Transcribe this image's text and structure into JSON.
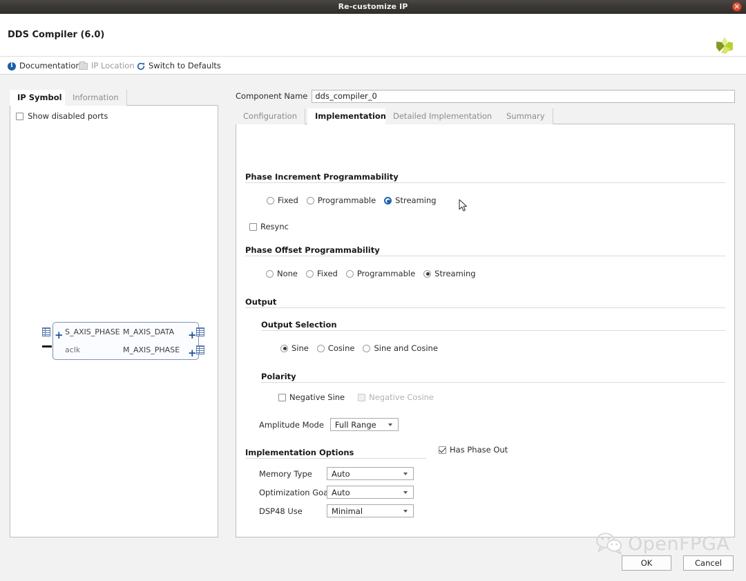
{
  "window": {
    "title": "Re-customize IP",
    "close_icon": "close-icon",
    "header_title": "DDS Compiler (6.0)",
    "logo_icon": "xilinx-logo-icon"
  },
  "toolbar": {
    "items": [
      {
        "label": "Documentation",
        "icon": "info-icon",
        "disabled": false
      },
      {
        "label": "IP Location",
        "icon": "folder-icon",
        "disabled": true
      },
      {
        "label": "Switch to Defaults",
        "icon": "refresh-icon",
        "disabled": false
      }
    ]
  },
  "left_panel": {
    "tabs": [
      {
        "label": "IP Symbol",
        "active": true
      },
      {
        "label": "Information",
        "active": false
      }
    ],
    "show_disabled_ports": {
      "label": "Show disabled ports",
      "checked": false
    },
    "ip_symbol": {
      "left_ports": [
        {
          "name": "S_AXIS_PHASE",
          "kind": "bus"
        },
        {
          "name": "aclk",
          "kind": "clock"
        }
      ],
      "right_ports": [
        {
          "name": "M_AXIS_DATA",
          "kind": "bus"
        },
        {
          "name": "M_AXIS_PHASE",
          "kind": "bus"
        }
      ]
    }
  },
  "main": {
    "component_name": {
      "label": "Component Name",
      "value": "dds_compiler_0"
    },
    "tabs": [
      {
        "label": "Configuration",
        "active": false
      },
      {
        "label": "Implementation",
        "active": true
      },
      {
        "label": "Detailed Implementation",
        "active": false
      },
      {
        "label": "Summary",
        "active": false
      }
    ],
    "phase_increment": {
      "title": "Phase Increment Programmability",
      "options": [
        {
          "label": "Fixed",
          "selected": false
        },
        {
          "label": "Programmable",
          "selected": false
        },
        {
          "label": "Streaming",
          "selected": true
        }
      ],
      "resync": {
        "label": "Resync",
        "checked": false
      }
    },
    "phase_offset": {
      "title": "Phase Offset Programmability",
      "options": [
        {
          "label": "None",
          "selected": false
        },
        {
          "label": "Fixed",
          "selected": false
        },
        {
          "label": "Programmable",
          "selected": false
        },
        {
          "label": "Streaming",
          "selected": true
        }
      ]
    },
    "output": {
      "title": "Output",
      "output_selection": {
        "title": "Output Selection",
        "options": [
          {
            "label": "Sine",
            "selected": true
          },
          {
            "label": "Cosine",
            "selected": false
          },
          {
            "label": "Sine and Cosine",
            "selected": false
          }
        ]
      },
      "polarity": {
        "title": "Polarity",
        "options": [
          {
            "label": "Negative Sine",
            "checked": false,
            "disabled": false
          },
          {
            "label": "Negative Cosine",
            "checked": false,
            "disabled": true
          }
        ]
      },
      "amplitude_mode": {
        "label": "Amplitude Mode",
        "value": "Full Range"
      }
    },
    "implementation_options": {
      "title": "Implementation Options",
      "fields": [
        {
          "label": "Memory Type",
          "value": "Auto"
        },
        {
          "label": "Optimization Goal",
          "value": "Auto"
        },
        {
          "label": "DSP48 Use",
          "value": "Minimal"
        }
      ]
    },
    "has_phase_out": {
      "label": "Has Phase Out",
      "checked": true
    }
  },
  "footer": {
    "ok_label": "OK",
    "cancel_label": "Cancel"
  },
  "watermark": {
    "text": "OpenFPGA",
    "icon": "wechat-bubble-icon"
  },
  "colors": {
    "accent_blue": "#1c5fb0",
    "titlebar": "#3b3835",
    "close_red": "#d1462a",
    "panel_border": "#bdbdbd"
  }
}
